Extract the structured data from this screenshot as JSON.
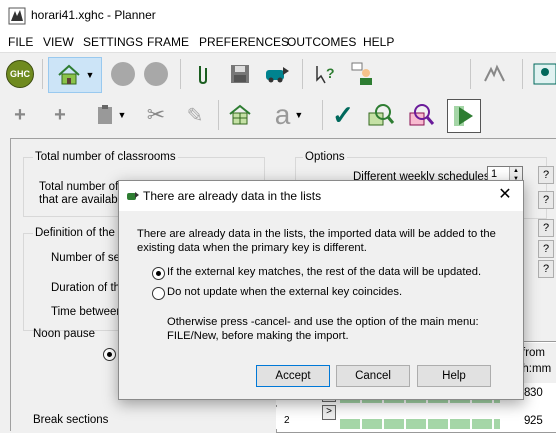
{
  "window": {
    "title": "horari41.xghc - Planner"
  },
  "menu": [
    "FILE",
    "VIEW",
    "SETTINGS",
    "FRAME",
    "PREFERENCES",
    "OUTCOMES",
    "HELP"
  ],
  "toolbar": {
    "logo_text": "GHC"
  },
  "main": {
    "total_classrooms": "Total number of classrooms",
    "total_of": "Total number of",
    "that_are_available": "that are available",
    "definition_of_the": "Definition of the fra",
    "number_of": "Number of sec",
    "duration_of": "Duration of the",
    "time_between": "Time between",
    "noon_pause": "Noon pause",
    "break_sections": "Break sections",
    "options": "Options",
    "different_weekly": "Different weekly schedules:",
    "weekly_value": "1",
    "help_glyph": "?",
    "grid_from": "from",
    "grid_hhmm": "hh:mm",
    "grid_row1": "1",
    "grid_row2": "2",
    "grid_8": "8",
    "grid_30": "30",
    "grid_9": "9",
    "grid_25": "25",
    "grid_arrow": ">"
  },
  "dialog": {
    "title": "There are already data in the lists",
    "message_line1": "There are already data in the lists, the imported data will be added to the",
    "message_line2": "existing data when the primary key is different.",
    "option1": "If the external key matches, the rest of the data will be updated.",
    "option2": "Do not update when the external key coincides.",
    "note_line1": "Otherwise press -cancel- and use the option of the main menu:",
    "note_line2": "FILE/New, before making the import.",
    "accept": "Accept",
    "cancel": "Cancel",
    "help": "Help",
    "close": "✕"
  }
}
